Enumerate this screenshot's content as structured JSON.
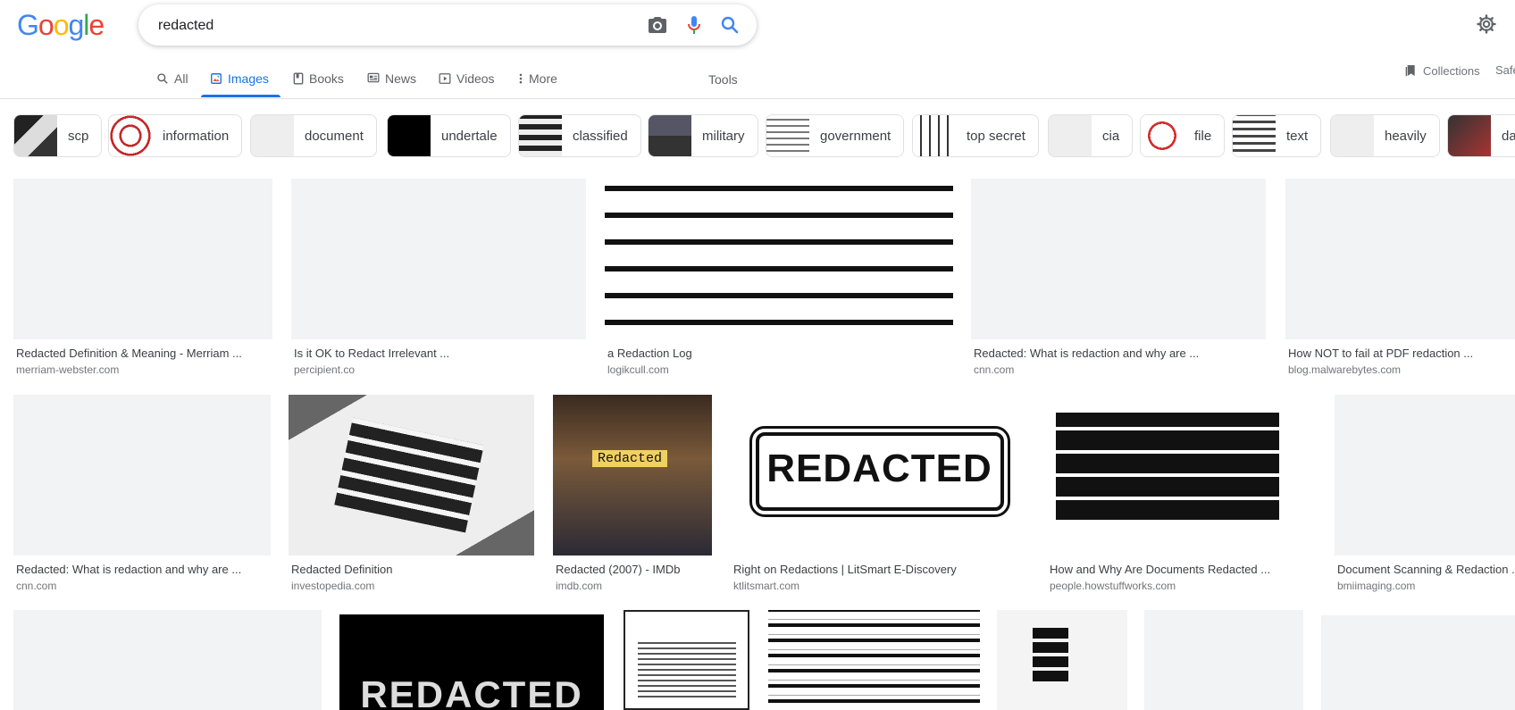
{
  "logo": {
    "letters": [
      "G",
      "o",
      "o",
      "g",
      "l",
      "e"
    ],
    "colors": [
      "#4285F4",
      "#EA4335",
      "#FBBC05",
      "#4285F4",
      "#34A853",
      "#EA4335"
    ]
  },
  "search": {
    "query": "redacted"
  },
  "tabs": [
    {
      "label": "All",
      "icon": "search-icon",
      "active": false
    },
    {
      "label": "Images",
      "icon": "image-icon",
      "active": true
    },
    {
      "label": "Books",
      "icon": "book-icon",
      "active": false
    },
    {
      "label": "News",
      "icon": "news-icon",
      "active": false
    },
    {
      "label": "Videos",
      "icon": "video-icon",
      "active": false
    },
    {
      "label": "More",
      "icon": "more-vert-icon",
      "active": false
    }
  ],
  "tools_label": "Tools",
  "collections_label": "Collections",
  "safesearch_label": "Safe",
  "chips": [
    "scp",
    "information",
    "document",
    "undertale",
    "classified",
    "military",
    "government",
    "top secret",
    "cia",
    "file",
    "text",
    "heavily",
    "da"
  ],
  "results": [
    {
      "title": "Redacted Definition & Meaning - Merriam ...",
      "site": "merriam-webster.com"
    },
    {
      "title": "Is it OK to Redact Irrelevant ...",
      "site": "percipient.co"
    },
    {
      "title": "a Redaction Log",
      "site": "logikcull.com"
    },
    {
      "title": "Redacted: What is redaction and why are ...",
      "site": "cnn.com"
    },
    {
      "title": "How NOT to fail at PDF redaction ...",
      "site": "blog.malwarebytes.com"
    },
    {
      "title": "Redacted: What is redaction and why are ...",
      "site": "cnn.com"
    },
    {
      "title": "Redacted Definition",
      "site": "investopedia.com"
    },
    {
      "title": "Redacted (2007) - IMDb",
      "site": "imdb.com"
    },
    {
      "title": "Right on Redactions | LitSmart E-Discovery",
      "site": "ktlitsmart.com"
    },
    {
      "title": "How and Why Are Documents Redacted ...",
      "site": "people.howstuffworks.com"
    },
    {
      "title": "Document Scanning & Redaction ...",
      "site": "bmiimaging.com"
    }
  ],
  "image_text": {
    "redacted_stamp": "REDACTED",
    "imdb_poster_title": "Redacted",
    "bottom_banner": "REDACTED"
  },
  "colors": {
    "accent": "#1a73e8",
    "chip_border": "#dfe1e5"
  }
}
